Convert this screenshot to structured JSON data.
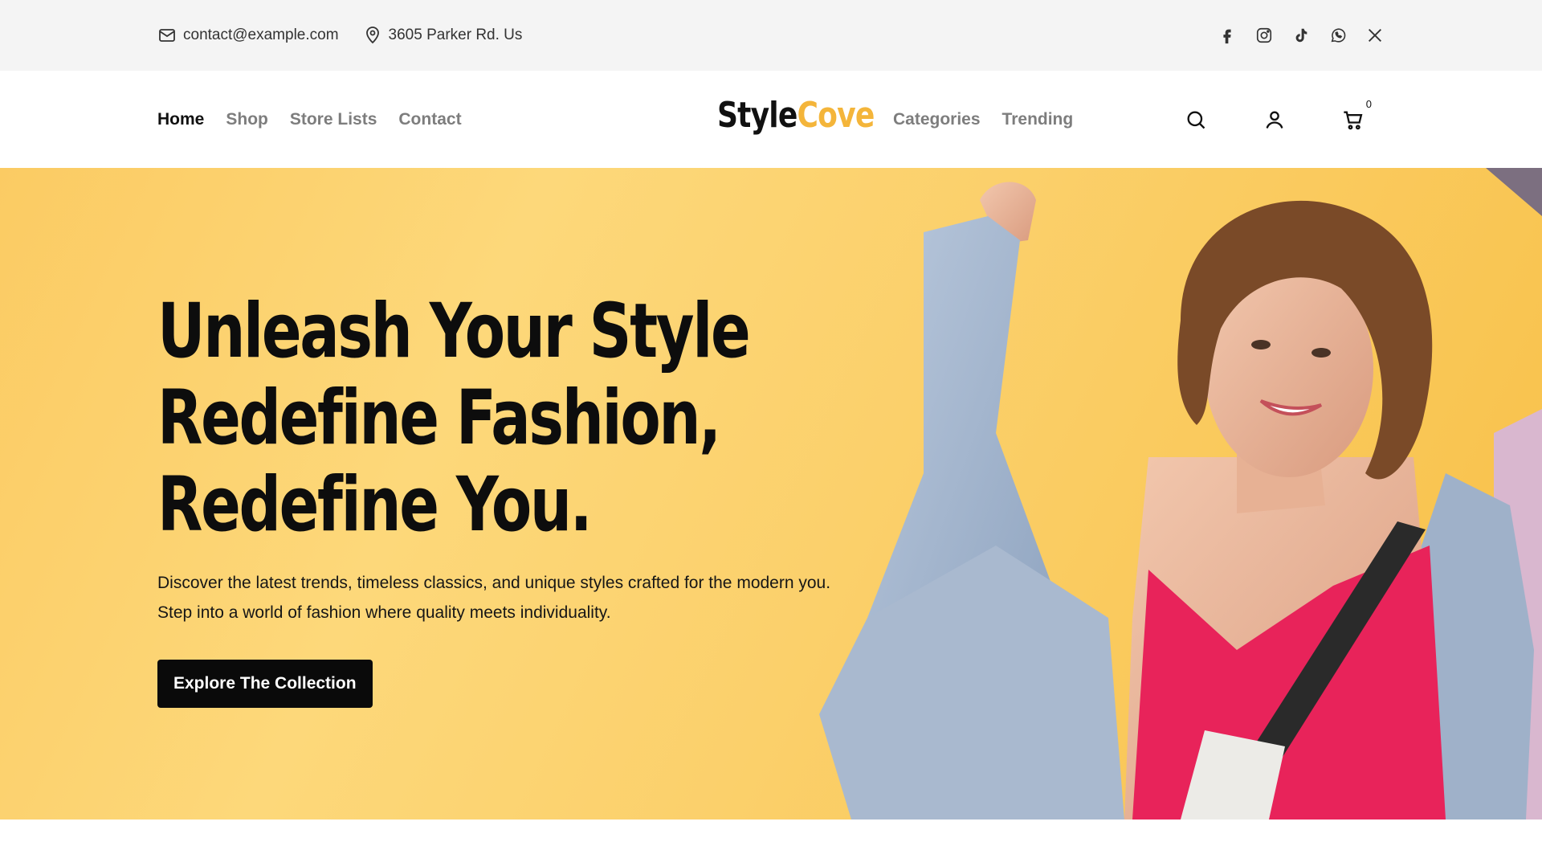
{
  "topbar": {
    "email": "contact@example.com",
    "address": "3605 Parker Rd. Us",
    "social": [
      "facebook-icon",
      "instagram-icon",
      "tiktok-icon",
      "whatsapp-icon",
      "x-icon"
    ]
  },
  "nav": {
    "left": [
      {
        "label": "Home",
        "active": true
      },
      {
        "label": "Shop"
      },
      {
        "label": "Store Lists"
      },
      {
        "label": "Contact"
      }
    ],
    "logo_part1": "Style",
    "logo_part2": "Cove",
    "right": [
      {
        "label": "Categories"
      },
      {
        "label": "Trending"
      }
    ],
    "cart_count": "0"
  },
  "hero": {
    "title_line1": "Unleash Your Style",
    "title_line2": "Redefine Fashion,",
    "title_line3": "Redefine You.",
    "description": "Discover the latest trends, timeless classics, and unique styles crafted for the modern you. Step into a world of fashion where quality meets individuality.",
    "cta_label": "Explore The Collection"
  },
  "colors": {
    "accent": "#f4b53a",
    "hero_bg": "#fbcb63",
    "button_bg": "#0a0a0a"
  }
}
